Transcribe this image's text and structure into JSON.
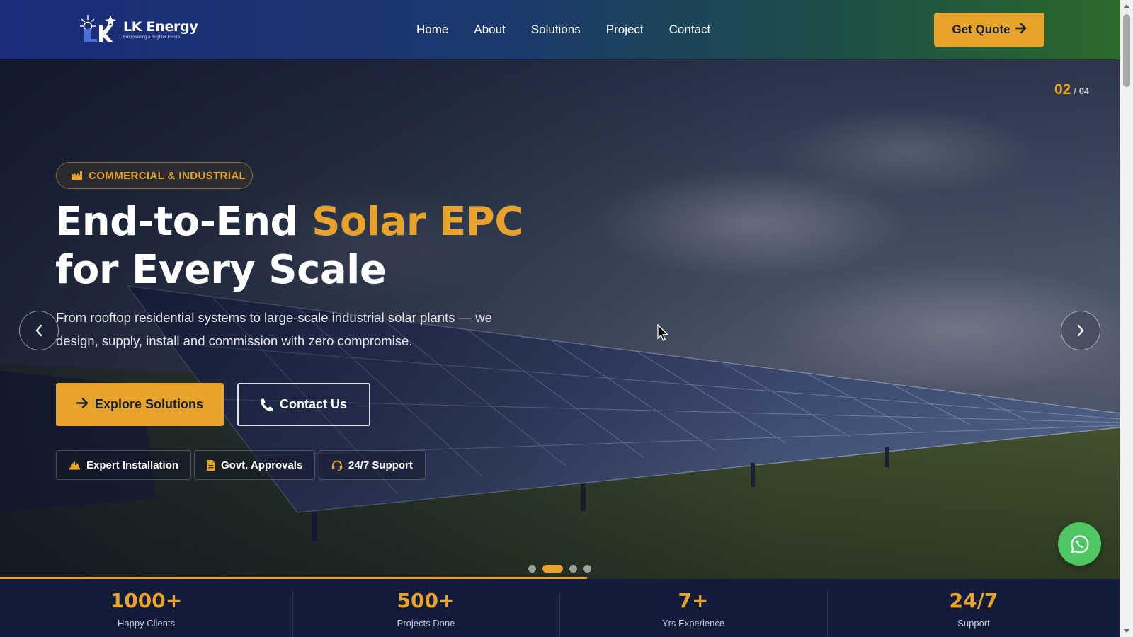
{
  "brand": {
    "name": "LK Energy",
    "tagline": "Empowering a Brighter Future"
  },
  "nav": {
    "items": [
      {
        "label": "Home"
      },
      {
        "label": "About"
      },
      {
        "label": "Solutions"
      },
      {
        "label": "Project"
      },
      {
        "label": "Contact"
      }
    ],
    "cta_label": "Get Quote"
  },
  "hero": {
    "slide_current": "02",
    "slide_separator": "/",
    "slide_total": "04",
    "badge": "COMMERCIAL & INDUSTRIAL",
    "headline_part1": "End-to-End ",
    "headline_highlight": "Solar EPC",
    "headline_part2": "for Every Scale",
    "description": "From rooftop residential systems to large-scale industrial solar plants — we design, supply, install and commission with zero compromise.",
    "primary_button": "Explore Solutions",
    "secondary_button": "Contact Us",
    "features": [
      {
        "label": "Expert Installation",
        "icon": "hard-hat-icon"
      },
      {
        "label": "Govt. Approvals",
        "icon": "document-icon"
      },
      {
        "label": "24/7 Support",
        "icon": "headset-icon"
      }
    ],
    "active_dot": 2,
    "dot_count": 4
  },
  "stats": [
    {
      "value": "1000+",
      "label": "Happy Clients"
    },
    {
      "value": "500+",
      "label": "Projects Done"
    },
    {
      "value": "7+",
      "label": "Yrs Experience"
    },
    {
      "value": "24/7",
      "label": "Support"
    }
  ],
  "colors": {
    "accent": "#e8a42a",
    "nav_gradient_start": "#1c2b7a",
    "nav_gradient_end": "#2a6a2a",
    "stats_bg": "#121b39",
    "whatsapp": "#4fc764"
  }
}
